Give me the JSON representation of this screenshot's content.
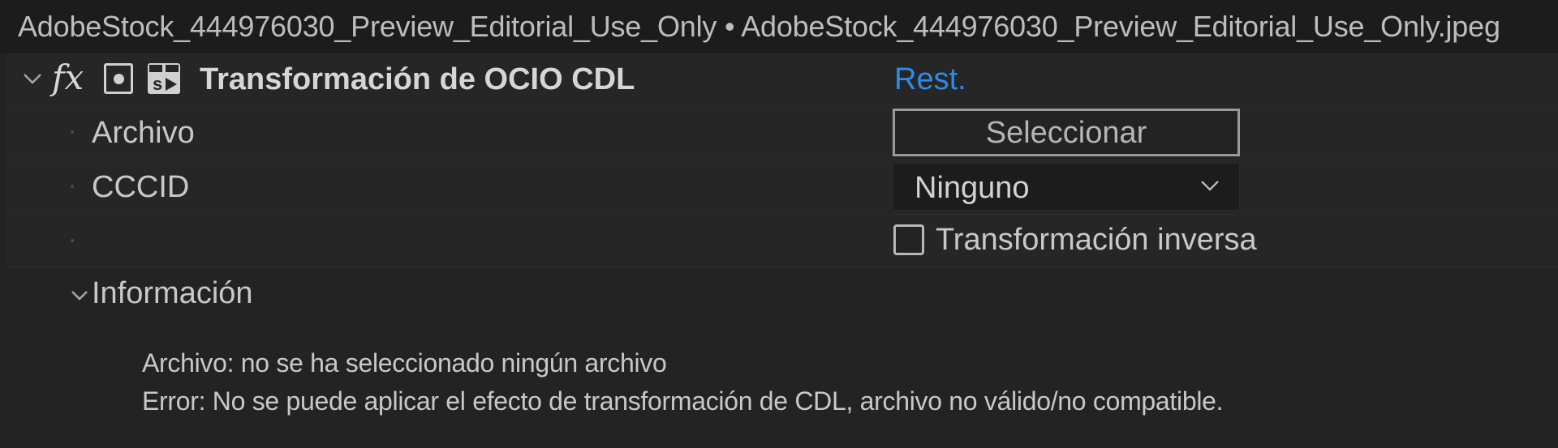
{
  "window": {
    "title": "AdobeStock_444976030_Preview_Editorial_Use_Only • AdobeStock_444976030_Preview_Editorial_Use_Only.jpeg"
  },
  "effect": {
    "fx_symbol": "fx",
    "name": "Transformación de OCIO CDL",
    "reset_label": "Rest.",
    "icons": [
      "chevron-down-icon",
      "fx-icon",
      "mask-icon",
      "script-icon"
    ]
  },
  "params": {
    "file": {
      "label": "Archivo",
      "button_label": "Seleccionar"
    },
    "cccid": {
      "label": "CCCID",
      "selected": "Ninguno"
    },
    "inverse": {
      "label": "Transformación inversa",
      "checked": false
    }
  },
  "info": {
    "label": "Información",
    "lines": [
      "Archivo: no se ha seleccionado ningún archivo",
      "Error: No se puede aplicar el efecto de transformación de CDL, archivo no válido/no compatible."
    ]
  },
  "colors": {
    "background": "#232323",
    "title_bar": "#1c1c1c",
    "accent_link": "#2d8ceb",
    "text": "#c8c8c8"
  }
}
